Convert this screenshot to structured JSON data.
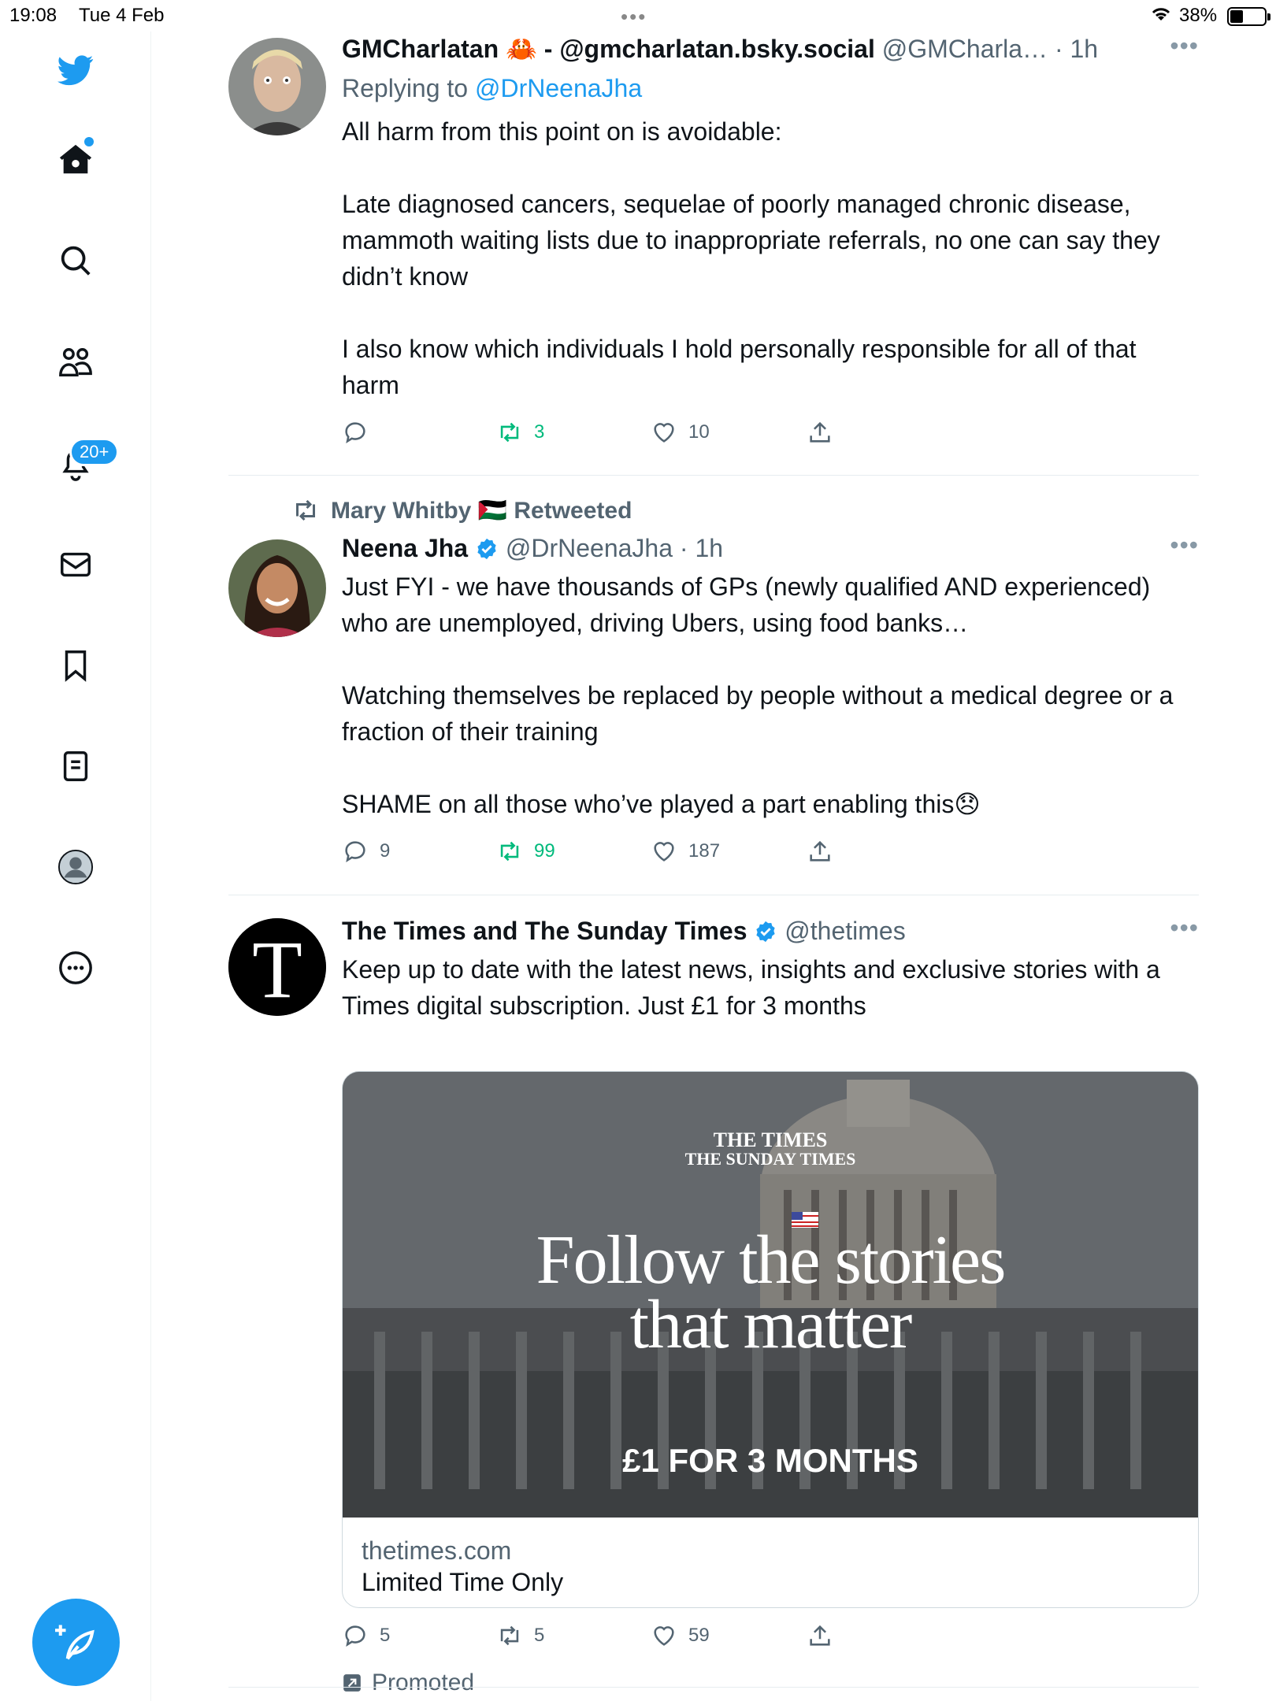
{
  "status_bar": {
    "time": "19:08",
    "date": "Tue 4 Feb",
    "battery": "38%",
    "battery_level": 0.38
  },
  "sidebar": {
    "notifications_badge": "20+",
    "accent_color": "#1d9bf0"
  },
  "tweets": [
    {
      "display_name": "GMCharlatan 🦀 - @gmcharlatan.bsky.social",
      "handle": "@GMCharla…",
      "time": "· 1h",
      "replying_prefix": "Replying to",
      "replying_to": "@DrNeenaJha",
      "text": "All harm from this point on is avoidable:\n\nLate diagnosed cancers, sequelae of poorly managed chronic disease, mammoth waiting lists due to inappropriate referrals, no one can say they didn’t know\n\nI also know which individuals I hold personally responsible for all of that harm",
      "replies": "",
      "retweets": "3",
      "likes": "10"
    },
    {
      "retweeted_by": "Mary Whitby 🇵🇸 Retweeted",
      "display_name": "Neena Jha",
      "handle": "@DrNeenaJha",
      "time": "· 1h",
      "text": "Just FYI - we have thousands of GPs (newly qualified AND experienced) who are unemployed, driving Ubers, using food banks…\n\nWatching themselves be replaced by people without a medical degree or a fraction of their training\n\nSHAME on all those who’ve played a part enabling this😞",
      "replies": "9",
      "retweets": "99",
      "likes": "187"
    },
    {
      "display_name": "The Times and The Sunday Times",
      "handle": "@thetimes",
      "text": "Keep up to date with the latest news, insights and exclusive stories with a Times digital subscription. Just £1 for 3 months",
      "card": {
        "logo_top": "THE TIMES",
        "logo_bottom": "THE SUNDAY TIMES",
        "headline_1": "Follow the stories",
        "headline_2": "that matter",
        "offer": "£1 FOR 3 MONTHS",
        "domain": "thetimes.com",
        "title": "Limited Time Only"
      },
      "replies": "5",
      "retweets": "5",
      "likes": "59",
      "promoted": "Promoted"
    }
  ]
}
